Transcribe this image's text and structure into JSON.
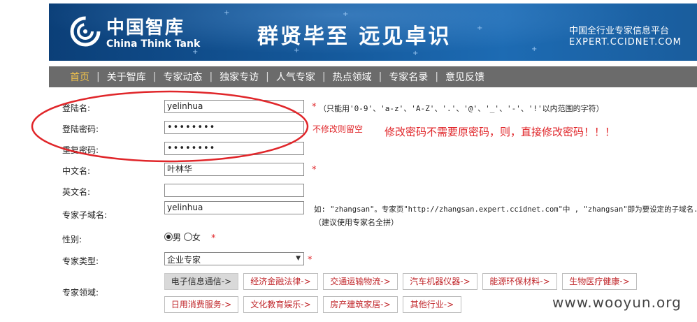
{
  "banner": {
    "logo_cn": "中国智库",
    "logo_en": "China Think Tank",
    "slogan": "群贤毕至  远见卓识",
    "platform": "中国全行业专家信息平台",
    "platform_url": "EXPERT.CCIDNET.COM"
  },
  "nav": {
    "items": [
      "首页",
      "关于智库",
      "专家动态",
      "独家专访",
      "人气专家",
      "热点领域",
      "专家名录",
      "意见反馈"
    ],
    "separator": "|",
    "active_index": 0
  },
  "form": {
    "login_name": {
      "label": "登陆名:",
      "value": "yelinhua",
      "hint": "（只能用'0-9'、'a-z'、'A-Z'、'.'、'@'、'_'、'-'、'!'以内范围的字符）"
    },
    "password": {
      "label": "登陆密码:",
      "value": "••••••••",
      "note": "不修改则留空"
    },
    "confirm_password": {
      "label": "重复密码:",
      "value": "••••••••"
    },
    "chinese_name": {
      "label": "中文名:",
      "value": "叶林华"
    },
    "english_name": {
      "label": "英文名:",
      "value": ""
    },
    "subdomain": {
      "label": "专家子域名:",
      "value": "yelinhua",
      "hint_line1": "如: \"zhangsan\"。专家页\"http://zhangsan.expert.ccidnet.com\"中 , \"zhangsan\"即为要设定的子域名.",
      "hint_line2": "（建议使用专家名全拼）"
    },
    "gender": {
      "label": "性别:",
      "options": [
        "男",
        "女"
      ],
      "selected": "男"
    },
    "expert_type": {
      "label": "专家类型:",
      "value": "企业专家"
    },
    "fields": {
      "label": "专家领域:",
      "row1": [
        "电子信息通信->",
        "经济金融法律->",
        "交通运输物流->",
        "汽车机器仪器->",
        "能源环保材料->",
        "生物医疗健康->"
      ],
      "row2": [
        "日用消费服务->",
        "文化教育娱乐->",
        "房产建筑家居->",
        "其他行业->"
      ],
      "selected": "电子信息通信->"
    },
    "required_mark": "*"
  },
  "annotation": {
    "text": "修改密码不需要原密码，则，直接修改密码！！！",
    "color": "#e0262a"
  },
  "watermark": "www.wooyun.org",
  "colors": {
    "banner_blue": "#155a9d",
    "nav_gray": "#6b6b6b",
    "nav_active": "#f0c24b",
    "accent_red": "#e0262a"
  }
}
